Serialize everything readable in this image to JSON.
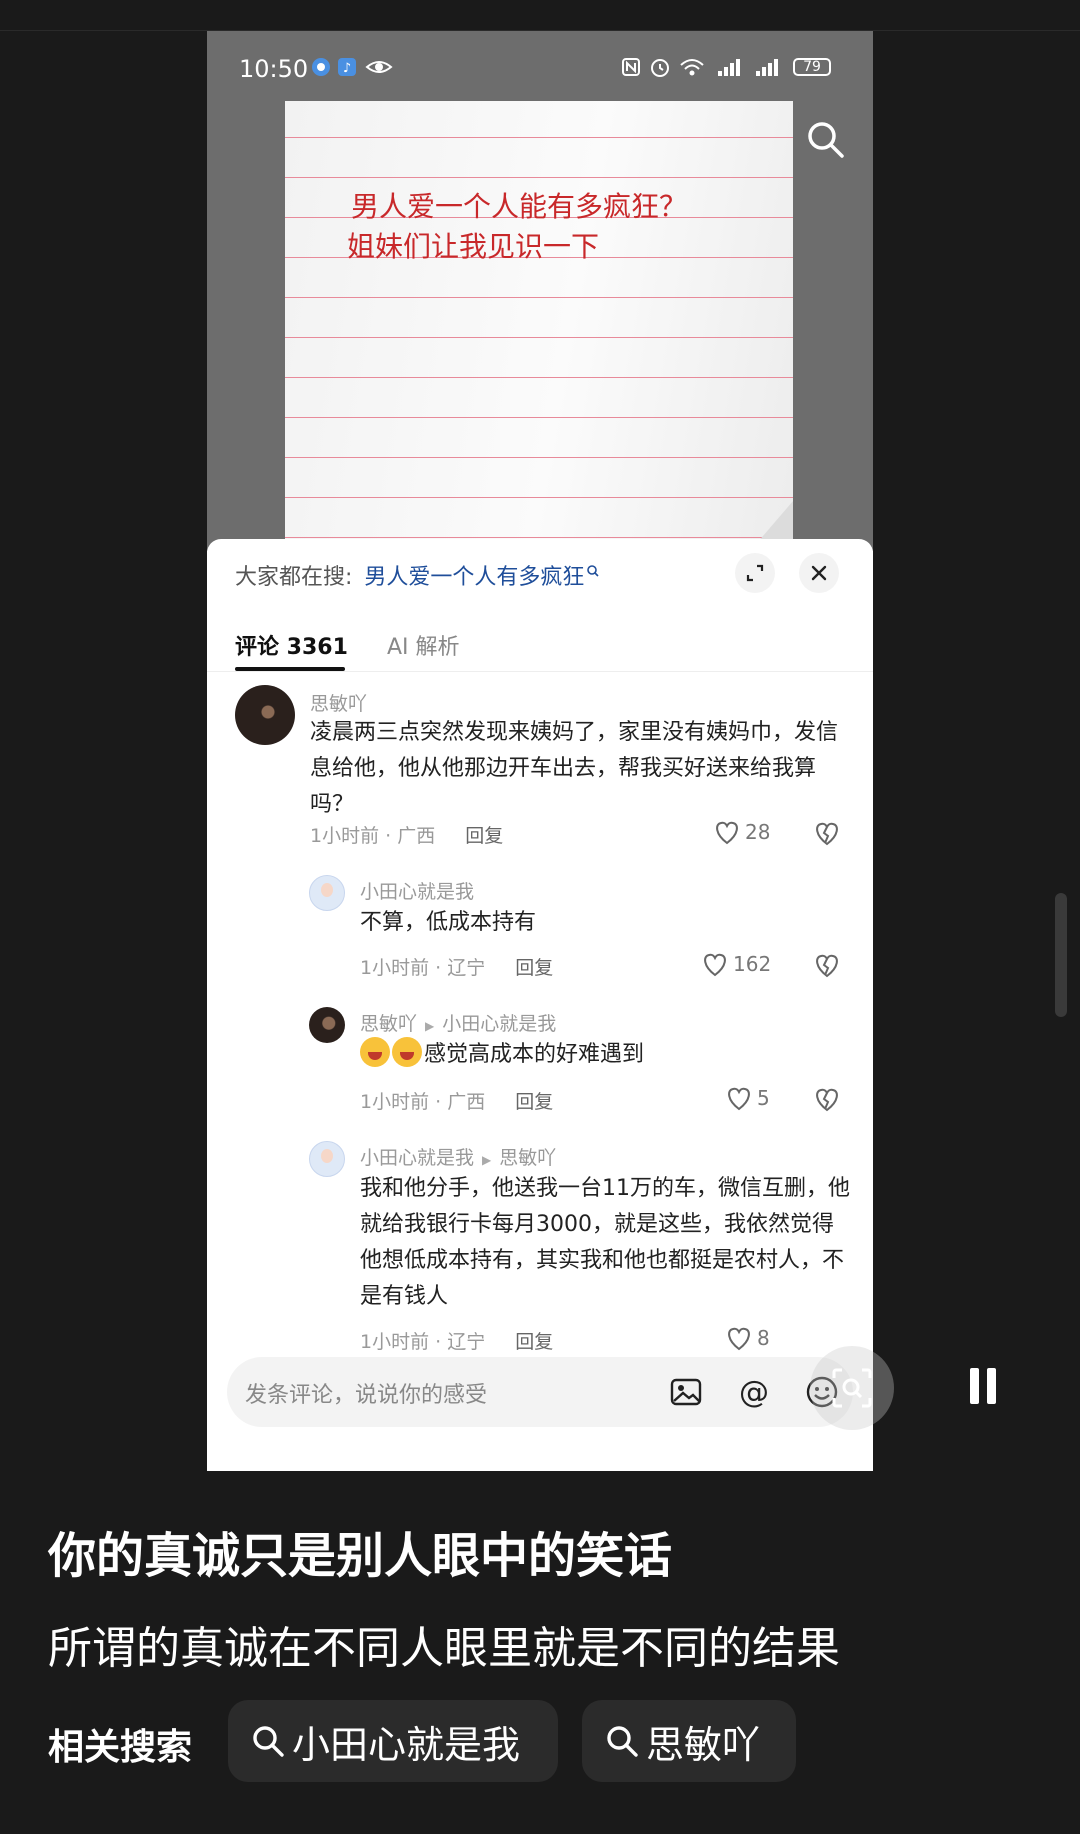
{
  "status_bar": {
    "time": "10:50",
    "battery": "79"
  },
  "video": {
    "handwriting_line1": "男人爱一个人能有多疯狂？",
    "handwriting_line2": "姐妹们让我见识一下"
  },
  "panel": {
    "hot_search_label": "大家都在搜:",
    "hot_search_keyword": "男人爱一个人有多疯狂",
    "tabs": [
      {
        "label": "评论 3361"
      },
      {
        "label": "AI 解析"
      }
    ]
  },
  "comments": [
    {
      "user": "思敏吖",
      "text": "凌晨两三点突然发现来姨妈了，家里没有姨妈巾，发信息给他，他从他那边开车出去，帮我买好送来给我算吗？",
      "time_location": "1小时前 · 广西",
      "reply_label": "回复",
      "likes": "28"
    },
    {
      "user": "小田心就是我",
      "text": "不算，低成本持有",
      "time_location": "1小时前 · 辽宁",
      "reply_label": "回复",
      "likes": "162"
    },
    {
      "user": "思敏吖",
      "reply_to": "小田心就是我",
      "text": "感觉高成本的好难遇到",
      "time_location": "1小时前 · 广西",
      "reply_label": "回复",
      "likes": "5"
    },
    {
      "user": "小田心就是我",
      "reply_to": "思敏吖",
      "text": "我和他分手，他送我一台11万的车，微信互删，他就给我银行卡每月3000，就是这些，我依然觉得他想低成本持有，其实我和他也都挺是农村人，不是有钱人",
      "time_location": "1小时前 · 辽宁",
      "reply_label": "回复",
      "likes": "8"
    }
  ],
  "input": {
    "placeholder": "发条评论，说说你的感受"
  },
  "post": {
    "title": "你的真诚只是别人眼中的笑话",
    "subtitle": "所谓的真诚在不同人眼里就是不同的结果",
    "related_label": "相关搜索",
    "related": [
      "小田心就是我",
      "思敏吖"
    ]
  }
}
